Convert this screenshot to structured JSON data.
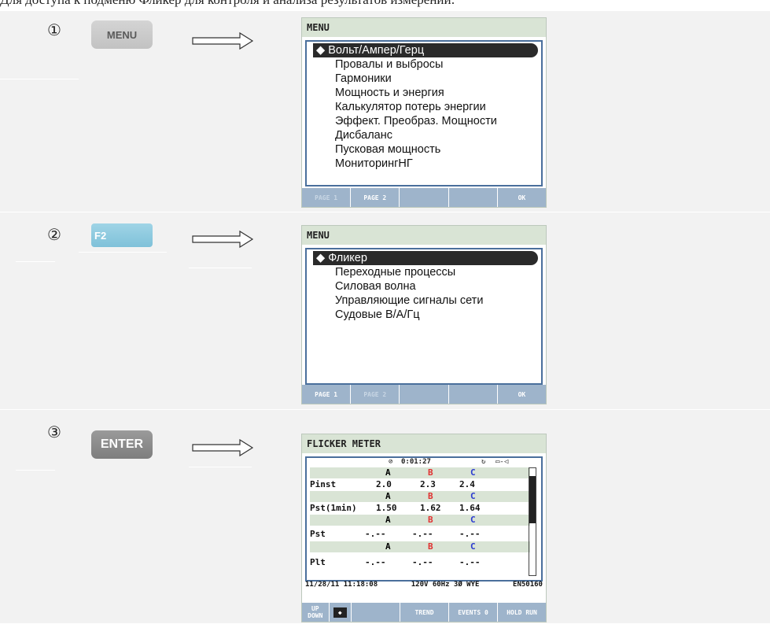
{
  "header_text": "Для доступа к подменю Фликер для контроля и анализа результатов измерений:",
  "steps": [
    {
      "number": "①",
      "key_label": "MENU",
      "screen": {
        "title": "MENU",
        "items": [
          "Вольт/Ампер/Герц",
          "Провалы и выбросы",
          "Гармоники",
          "Мощность и энергия",
          "Калькулятор потерь энергии",
          "Эффект. Преобраз. Мощности",
          "Дисбаланс",
          "Пусковая мощность",
          "МониторингНГ"
        ],
        "fkeys": [
          "PAGE 1",
          "PAGE 2",
          "",
          "",
          "OK"
        ]
      }
    },
    {
      "number": "②",
      "key_label": "F2",
      "screen": {
        "title": "MENU",
        "items": [
          "Фликер",
          "Переходные процессы",
          "Силовая волна",
          "Управляющие сигналы сети",
          "Судовые В/А/Гц"
        ],
        "fkeys": [
          "PAGE 1",
          "PAGE 2",
          "",
          "",
          "OK"
        ]
      }
    },
    {
      "number": "③",
      "key_label": "ENTER",
      "screen": {
        "title": "FLICKER METER",
        "timer": "0:01:27",
        "phases": [
          "A",
          "B",
          "C"
        ],
        "rows": [
          {
            "label": "Pinst",
            "values": [
              "2.0",
              "2.3",
              "2.4"
            ]
          },
          {
            "label": "Pst(1min)",
            "values": [
              "1.50",
              "1.62",
              "1.64"
            ]
          },
          {
            "label": "Pst",
            "values": [
              "-.--",
              "-.--",
              "-.--"
            ]
          },
          {
            "label": "Plt",
            "values": [
              "-.--",
              "-.--",
              "-.--"
            ]
          }
        ],
        "info": {
          "datetime": "11/28/11 11:18:08",
          "config": "120V 60Hz 3Ø WYE",
          "standard": "EN50160"
        },
        "fkeys": [
          "UP DOWN",
          "",
          "TREND",
          "EVENTS 0",
          "HOLD RUN"
        ]
      }
    }
  ],
  "colors": {
    "phase_a": "#222222",
    "phase_b": "#e03030",
    "phase_c": "#2a3ad0",
    "fkey_bar": "#9eb4cb",
    "title_bar": "#d9e4d5"
  }
}
